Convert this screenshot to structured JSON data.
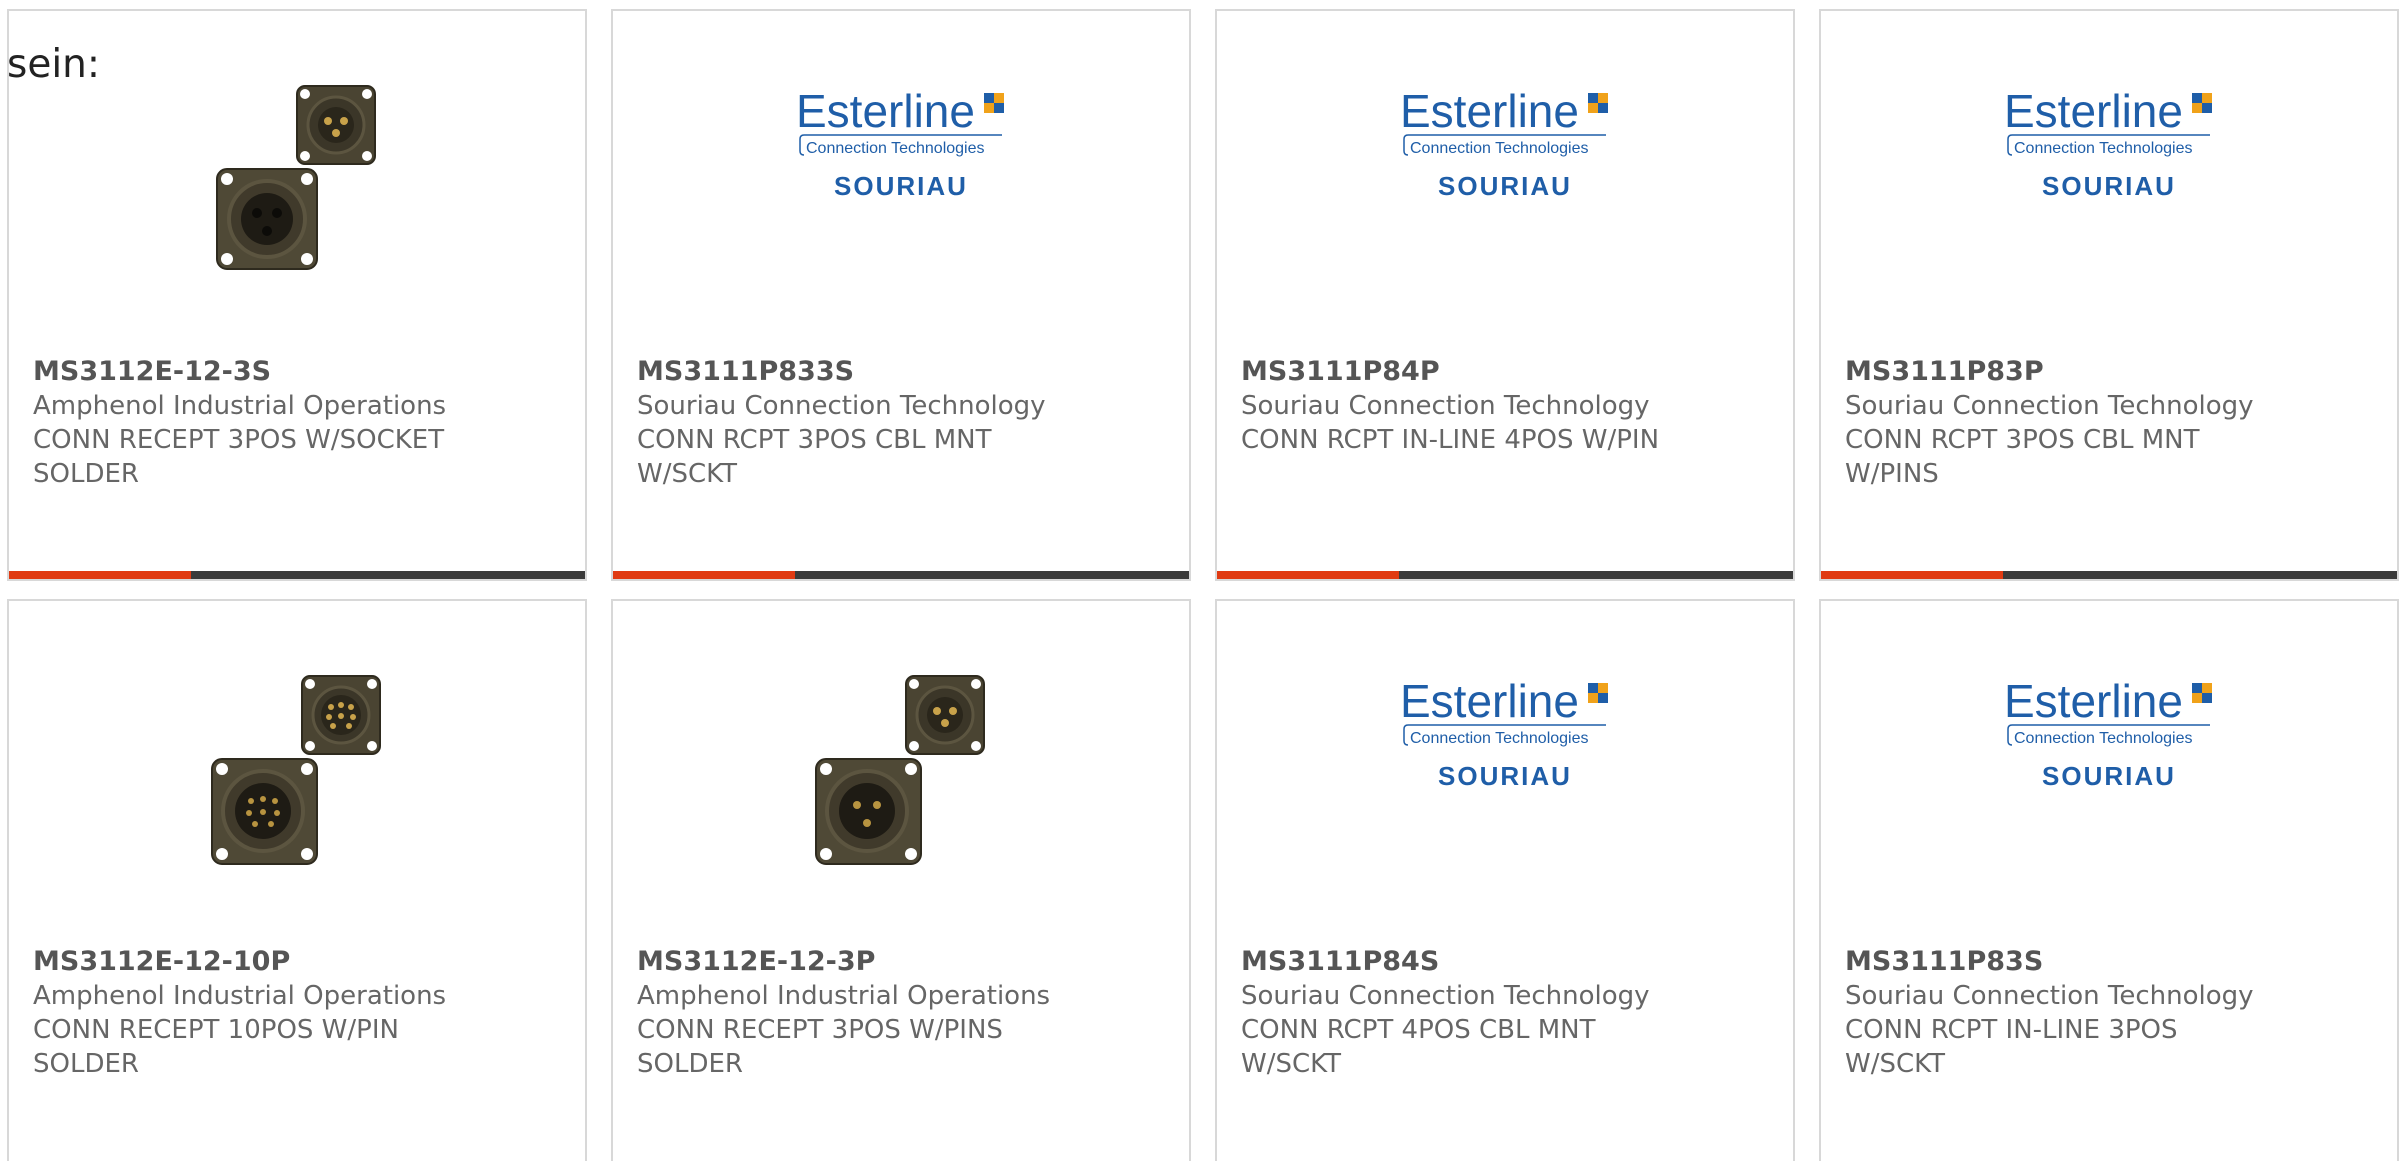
{
  "intro_text": "sein:",
  "colors": {
    "accent": "#e03a12",
    "bar": "#3a3a3a",
    "brand_blue": "#1f5ea8"
  },
  "brand_logo_texts": {
    "wordmark": "Esterline",
    "tagline": "Connection Technologies",
    "sub": "SOURIAU"
  },
  "products": [
    {
      "part_number": "MS3112E-12-3S",
      "manufacturer": "Amphenol Industrial Operations",
      "description": "CONN RECEPT 3POS W/SOCKET SOLDER",
      "image": "connector-photo-3pos"
    },
    {
      "part_number": "MS3111P833S",
      "manufacturer": "Souriau Connection Technology",
      "description": "CONN RCPT 3POS CBL MNT W/SCKT",
      "image": "esterline-souriau-logo"
    },
    {
      "part_number": "MS3111P84P",
      "manufacturer": "Souriau Connection Technology",
      "description": "CONN RCPT IN-LINE 4POS W/PIN",
      "image": "esterline-souriau-logo"
    },
    {
      "part_number": "MS3111P83P",
      "manufacturer": "Souriau Connection Technology",
      "description": "CONN RCPT 3POS CBL MNT W/PINS",
      "image": "esterline-souriau-logo"
    },
    {
      "part_number": "MS3112E-12-10P",
      "manufacturer": "Amphenol Industrial Operations",
      "description": "CONN RECEPT 10POS W/PIN SOLDER",
      "image": "connector-photo-10pos"
    },
    {
      "part_number": "MS3112E-12-3P",
      "manufacturer": "Amphenol Industrial Operations",
      "description": "CONN RECEPT 3POS W/PINS SOLDER",
      "image": "connector-photo-3pos-pins"
    },
    {
      "part_number": "MS3111P84S",
      "manufacturer": "Souriau Connection Technology",
      "description": "CONN RCPT 4POS CBL MNT W/SCKT",
      "image": "esterline-souriau-logo"
    },
    {
      "part_number": "MS3111P83S",
      "manufacturer": "Souriau Connection Technology",
      "description": "CONN RCPT IN-LINE 3POS W/SCKT",
      "image": "esterline-souriau-logo"
    }
  ]
}
